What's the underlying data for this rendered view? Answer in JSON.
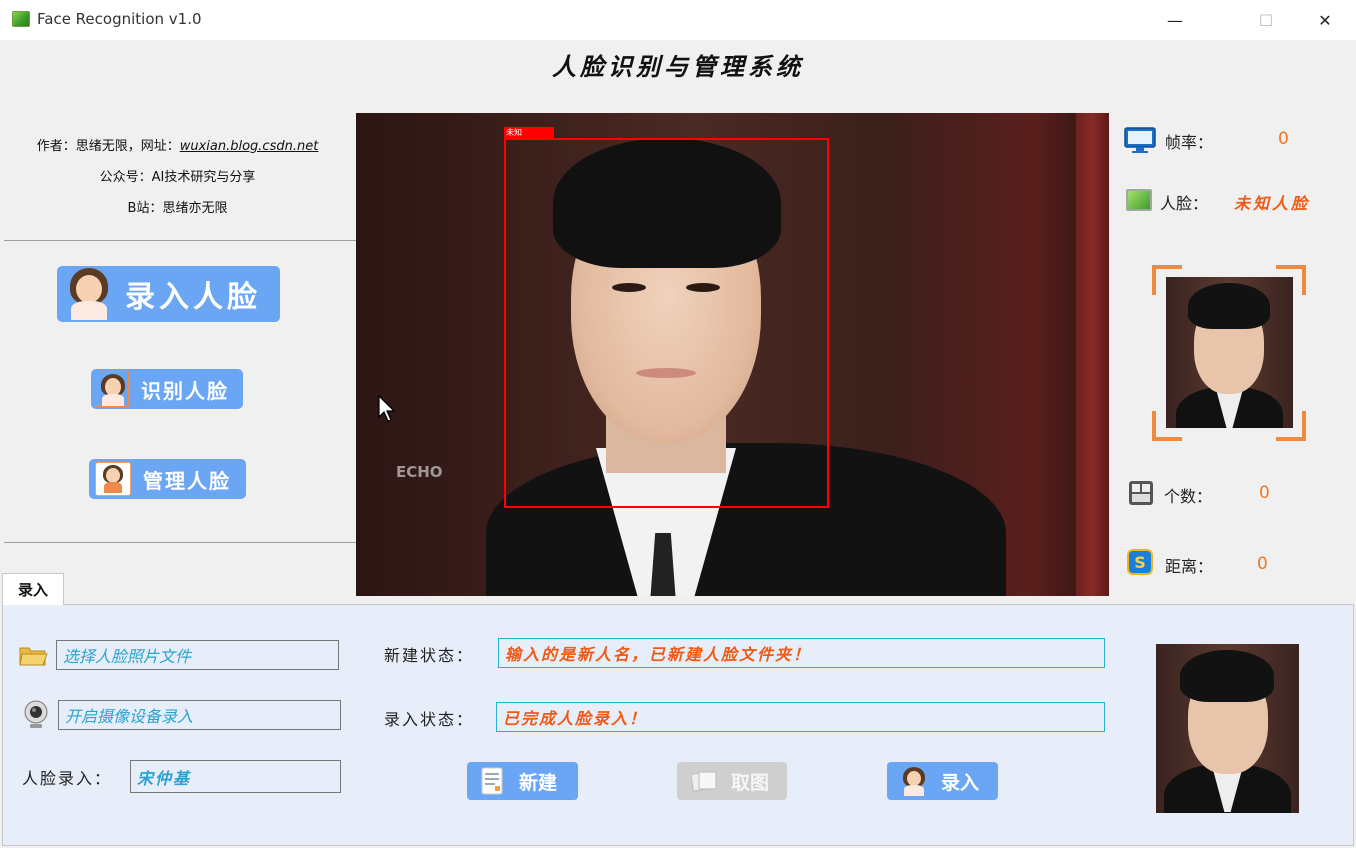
{
  "window": {
    "title": "Face Recognition v1.0",
    "minimize": "—",
    "maximize": "☐",
    "close": "✕"
  },
  "heading": "人脸识别与管理系统",
  "info": {
    "author_prefix": "作者：思绪无限，网址：",
    "author_link": "wuxian.blog.csdn.net",
    "wechat": "公众号：AI技术研究与分享",
    "bilibili": "B站：思绪亦无限"
  },
  "nav": {
    "enroll": "录入人脸",
    "recognize": "识别人脸",
    "manage": "管理人脸"
  },
  "video": {
    "box_label": "未知",
    "watermark": "ECHO"
  },
  "side": {
    "fps_label": "帧率：",
    "fps_value": "0",
    "face_label": "人脸：",
    "face_value": "未知人脸",
    "count_label": "个数：",
    "count_value": "0",
    "distance_label": "距离：",
    "distance_value": "0"
  },
  "tab": {
    "label": "录入"
  },
  "enroll": {
    "select_file": "选择人脸照片文件",
    "open_camera": "开启摄像设备录入",
    "name_label": "人脸录入：",
    "name_value": "宋仲基",
    "new_status_label": "新建状态：",
    "new_status_value": "输入的是新人名，已新建人脸文件夹！",
    "enroll_status_label": "录入状态：",
    "enroll_status_value": "已完成人脸录入！",
    "btn_new": "新建",
    "btn_capture": "取图",
    "btn_enroll": "录入"
  },
  "colors": {
    "accent_blue": "#6aa6f4",
    "value_orange": "#f47522",
    "box_red": "#ff0000",
    "field_cyan": "#2ab0d6"
  },
  "icons": [
    "app-icon",
    "monitor-icon",
    "face-image-icon",
    "calculator-icon",
    "distance-icon",
    "folder-icon",
    "webcam-icon",
    "document-icon",
    "photos-icon",
    "avatar-icon"
  ]
}
